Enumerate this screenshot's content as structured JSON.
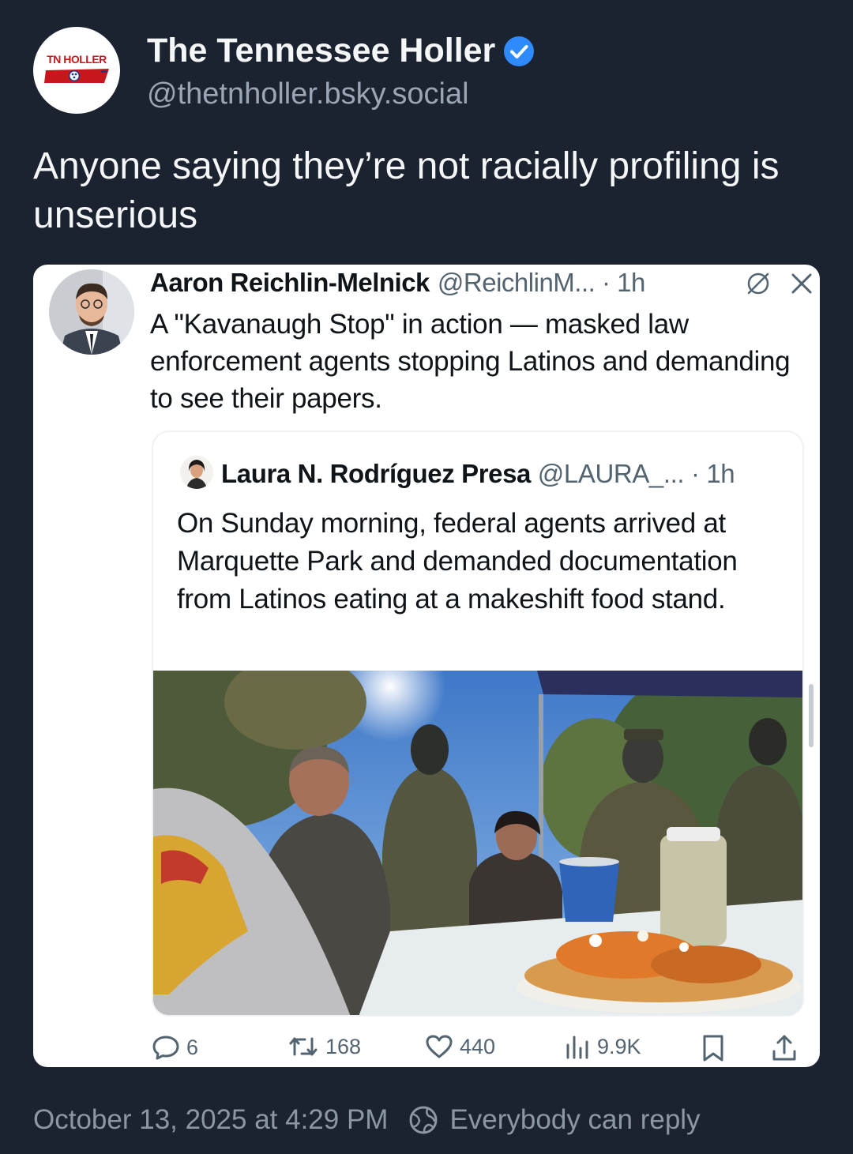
{
  "post": {
    "author": {
      "display_name": "The Tennessee Holler",
      "handle": "@thetnholler.bsky.social",
      "avatar_text": "TN HOLLER",
      "verified": true
    },
    "text": "Anyone saying they’re not racially profiling is unserious",
    "timestamp": "October 13, 2025 at 4:29 PM",
    "reply_setting": "Everybody can reply"
  },
  "quoted_tweet": {
    "name": "Aaron Reichlin-Melnick",
    "handle_time": "@ReichlinM... · 1h",
    "text": "A \"Kavanaugh Stop\" in action — masked law enforcement agents stopping Latinos and demanding to see their papers.",
    "stats": {
      "replies": "6",
      "reposts": "168",
      "likes": "440",
      "views": "9.9K"
    }
  },
  "inner_quote": {
    "name": "Laura N. Rodríguez Presa",
    "handle_time": "@LAURA_... · 1h",
    "text": "On Sunday morning, federal agents arrived at Marquette Park and demanded documentation from Latinos eating at a makeshift food stand."
  },
  "icons": {
    "verified": "verified-badge-icon",
    "grok": "slashed-circle-icon",
    "close": "close-icon",
    "reply": "reply-bubble-icon",
    "repost": "repost-icon",
    "like": "heart-icon",
    "views": "views-bars-icon",
    "bookmark": "bookmark-icon",
    "share": "share-upload-icon",
    "globe": "globe-icon"
  },
  "colors": {
    "background": "#1c2330",
    "verified": "#2f8bfd",
    "card": "#ffffff",
    "muted": "#536471"
  }
}
